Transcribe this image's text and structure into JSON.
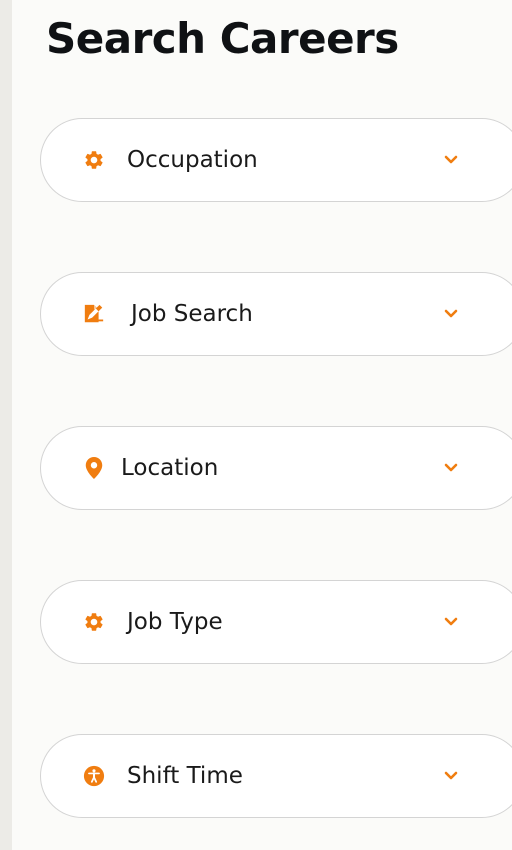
{
  "page": {
    "title": "Search Careers"
  },
  "colors": {
    "accent": "#f07d10",
    "text": "#1a1a1a",
    "border": "#d4d4d4"
  },
  "filters": [
    {
      "label": "Occupation",
      "icon": "gear-icon"
    },
    {
      "label": "Job Search",
      "icon": "document-edit-icon"
    },
    {
      "label": "Location",
      "icon": "map-pin-icon"
    },
    {
      "label": "Job Type",
      "icon": "gear-icon"
    },
    {
      "label": "Shift Time",
      "icon": "accessibility-icon"
    }
  ],
  "chevron_icon": "chevron-down-icon"
}
